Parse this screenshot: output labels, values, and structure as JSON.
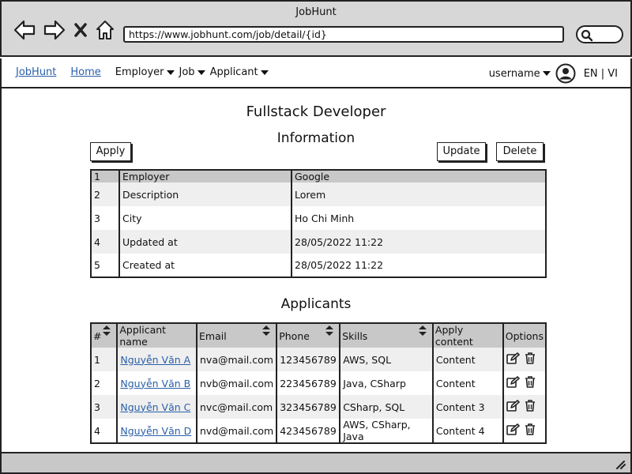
{
  "window": {
    "title": "JobHunt",
    "url": "https://www.jobhunt.com/job/detail/{id}"
  },
  "nav": {
    "brand": "JobHunt",
    "home": "Home",
    "menus": [
      "Employer",
      "Job",
      "Applicant"
    ],
    "username": "username",
    "lang": "EN | VI"
  },
  "page": {
    "title": "Fullstack Developer",
    "info_heading": "Information",
    "applicants_heading": "Applicants"
  },
  "buttons": {
    "apply": "Apply",
    "update": "Update",
    "delete": "Delete"
  },
  "info_rows": [
    {
      "num": "1",
      "field": "Employer",
      "value": "Google"
    },
    {
      "num": "2",
      "field": "Description",
      "value": "Lorem"
    },
    {
      "num": "3",
      "field": "City",
      "value": "Ho Chi Minh"
    },
    {
      "num": "4",
      "field": "Updated at",
      "value": "28/05/2022 11:22"
    },
    {
      "num": "5",
      "field": "Created at",
      "value": "28/05/2022 11:22"
    }
  ],
  "applicants": {
    "columns": [
      "#",
      "Applicant name",
      "Email",
      "Phone",
      "Skills",
      "Apply content",
      "Options"
    ],
    "rows": [
      {
        "num": "1",
        "name": "Nguyễn Văn A",
        "email": "nva@mail.com",
        "phone": "123456789",
        "skills": "AWS, SQL",
        "content": "Content"
      },
      {
        "num": "2",
        "name": "Nguyễn Văn B",
        "email": "nvb@mail.com",
        "phone": "223456789",
        "skills": "Java, CSharp",
        "content": "Content"
      },
      {
        "num": "3",
        "name": "Nguyễn Văn C",
        "email": "nvc@mail.com",
        "phone": "323456789",
        "skills": "CSharp, SQL",
        "content": "Content 3"
      },
      {
        "num": "4",
        "name": "Nguyễn Văn D",
        "email": "nvd@mail.com",
        "phone": "423456789",
        "skills": "AWS, CSharp, Java",
        "content": "Content 4"
      }
    ]
  },
  "icons": [
    "back-icon",
    "forward-icon",
    "close-icon",
    "home-icon",
    "search-icon",
    "user-icon",
    "edit-icon",
    "trash-icon",
    "sort-icon",
    "resize-grip-icon"
  ]
}
